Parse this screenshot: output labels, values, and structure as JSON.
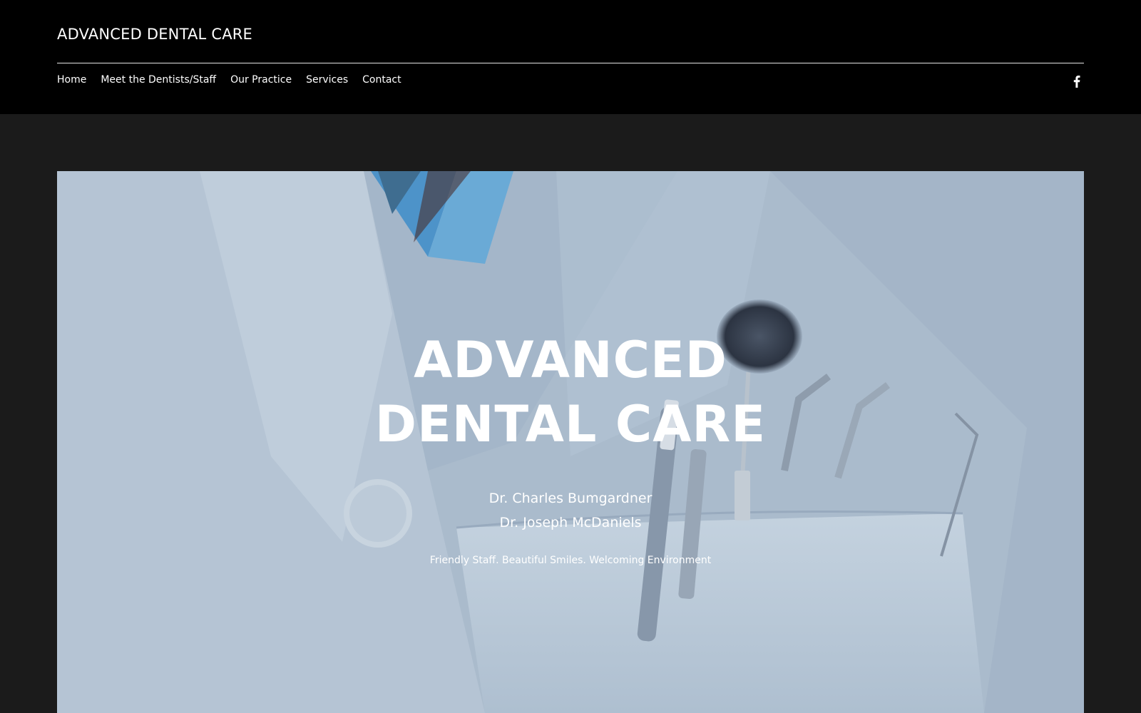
{
  "header": {
    "site_title": "ADVANCED DENTAL CARE",
    "nav": [
      {
        "label": "Home"
      },
      {
        "label": "Meet the Dentists/Staff"
      },
      {
        "label": "Our Practice"
      },
      {
        "label": "Services"
      },
      {
        "label": "Contact"
      }
    ],
    "social_icon": "facebook-icon"
  },
  "hero": {
    "title": "ADVANCED DENTAL CARE",
    "doctors": [
      "Dr. Charles Bumgardner",
      "Dr. Joseph McDaniels"
    ],
    "tagline": "Friendly Staff. Beautiful Smiles. Welcoming Environment",
    "background_image": "dentist-coat-with-tools-photo"
  },
  "colors": {
    "header_bg": "#000000",
    "page_bg": "#1b1b1b",
    "text": "#ffffff"
  }
}
